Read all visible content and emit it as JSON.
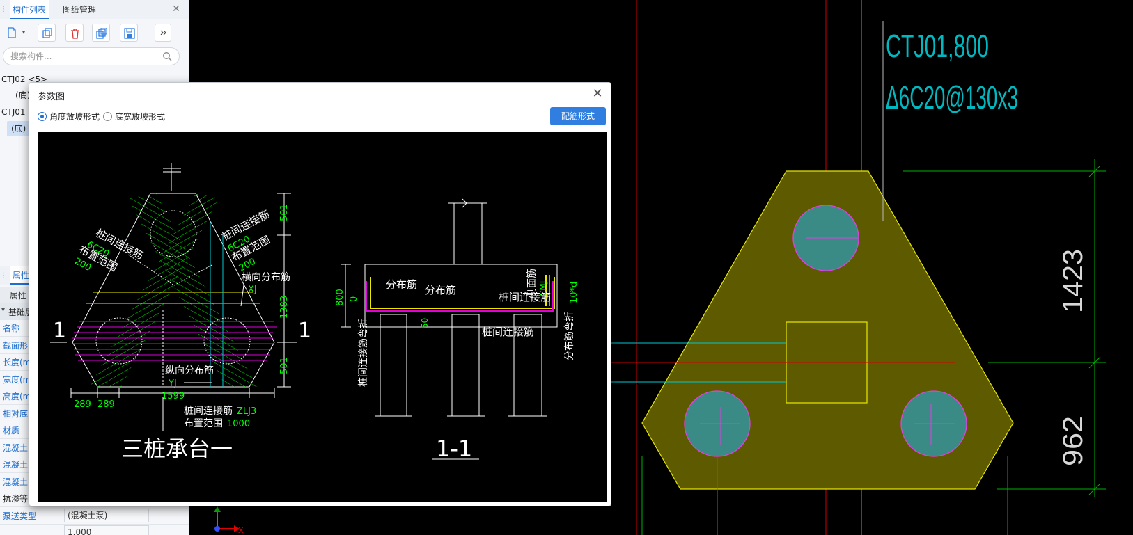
{
  "left_panel": {
    "tabs": [
      "构件列表",
      "图纸管理"
    ],
    "search_placeholder": "搜索构件...",
    "tree": [
      {
        "label": "CTJ02 <5>"
      },
      {
        "label": "(底)"
      },
      {
        "label": "CTJ01"
      },
      {
        "label": "(底)"
      }
    ],
    "props_tab": "属性",
    "props_head": "属性",
    "props_group": "基础层",
    "props": [
      {
        "name": "名称",
        "value": ""
      },
      {
        "name": "截面形",
        "value": ""
      },
      {
        "name": "长度(m",
        "value": ""
      },
      {
        "name": "宽度(m",
        "value": ""
      },
      {
        "name": "高度(m",
        "value": ""
      },
      {
        "name": "相对底",
        "value": ""
      },
      {
        "name": "材质",
        "value": ""
      },
      {
        "name": "混凝土",
        "value": ""
      },
      {
        "name": "混凝土",
        "value": ""
      },
      {
        "name": "混凝土",
        "value": ""
      },
      {
        "name": "抗渗等",
        "value": ""
      },
      {
        "name": "泵送类型",
        "value": "(混凝土泵)"
      },
      {
        "name": "",
        "value": "1.000"
      }
    ]
  },
  "canvas": {
    "label_top_1": "CTJ01,800",
    "label_top_2": "Δ6C20@130x3",
    "dim_1": "1423",
    "dim_2": "962",
    "axis_x": "X",
    "colors": {
      "pile_cap": "#5e5a00",
      "pile": "#3a8a86",
      "cyan": "#00c8d0",
      "green": "#00b000",
      "red": "#d00000"
    }
  },
  "dialog": {
    "title": "参数图",
    "radio_1": "角度放坡形式",
    "radio_2": "底宽放坡形式",
    "button": "配筋形式",
    "drawing": {
      "plan_title": "三桩承台一",
      "section_title": "1-1",
      "section_mark": "1",
      "lbl_link_left": "桩间连接筋",
      "val_link_left": "6C20",
      "lbl_range_left": "布置范围",
      "val_range_left": "200",
      "lbl_link_right": "桩间连接筋",
      "val_link_right": "6C20",
      "lbl_range_right": "布置范围",
      "val_range_right": "200",
      "lbl_trans": "横向分布筋",
      "val_trans": "XJ",
      "lbl_long": "纵向分布筋",
      "val_long": "YJ",
      "lbl_link_bottom": "桩间连接筋",
      "val_link_bottom": "ZLJ3",
      "lbl_range_bottom": "布置范围",
      "val_range_bottom": "1000",
      "dim_501_top": "501",
      "dim_1383": "1383",
      "dim_501_bot": "501",
      "dim_289_a": "289",
      "dim_289_b": "289",
      "dim_1599": "1599",
      "sec_dist_1": "分布筋",
      "sec_dist_2": "分布筋",
      "sec_link": "桩间连接筋",
      "sec_link_bottom": "桩间连接筋",
      "sec_side": "侧面筋",
      "sec_side_val": "CMJ",
      "sec_dim_800": "800",
      "sec_dim_0": "0",
      "sec_dim_50": "50",
      "sec_10d": "10*d",
      "sec_vert_left": "桩间连接筋弯折",
      "sec_vert_right": "分布筋弯折"
    }
  }
}
